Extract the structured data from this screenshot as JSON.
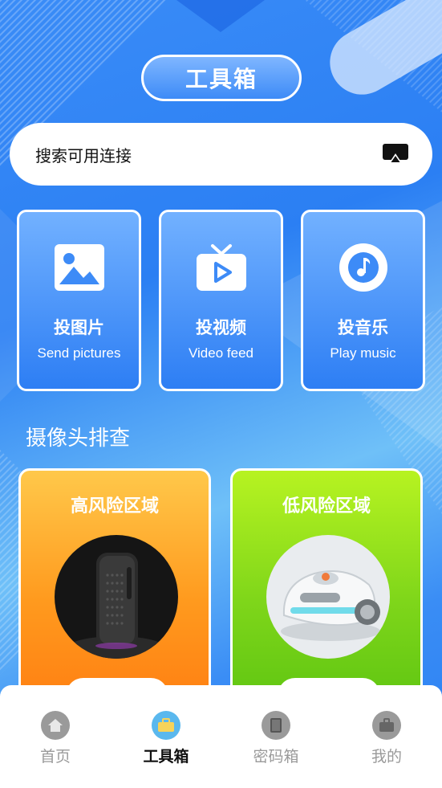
{
  "header": {
    "title": "工具箱"
  },
  "search": {
    "label": "搜索可用连接",
    "icon": "screen-cast-icon"
  },
  "cast_cards": [
    {
      "title": "投图片",
      "subtitle": "Send pictures",
      "icon": "image-icon"
    },
    {
      "title": "投视频",
      "subtitle": "Video feed",
      "icon": "tv-play-icon"
    },
    {
      "title": "投音乐",
      "subtitle": "Play music",
      "icon": "music-note-icon"
    }
  ],
  "camera_section": {
    "title": "摄像头排查"
  },
  "risk_cards": [
    {
      "label": "高风险区域",
      "image": "speaker-photo"
    },
    {
      "label": "低风险区域",
      "image": "robot-cleaner-photo"
    }
  ],
  "tabbar": {
    "items": [
      {
        "label": "首页",
        "icon": "home-icon",
        "active": false
      },
      {
        "label": "工具箱",
        "icon": "toolbox-icon",
        "active": true
      },
      {
        "label": "密码箱",
        "icon": "password-book-icon",
        "active": false
      },
      {
        "label": "我的",
        "icon": "profile-icon",
        "active": false
      }
    ]
  },
  "colors": {
    "primary_blue": "#2f86f5",
    "high_risk": "#ff8f1a",
    "low_risk": "#8cd81c",
    "tab_active_text": "#111111",
    "tab_inactive_text": "#9a9a9a"
  }
}
